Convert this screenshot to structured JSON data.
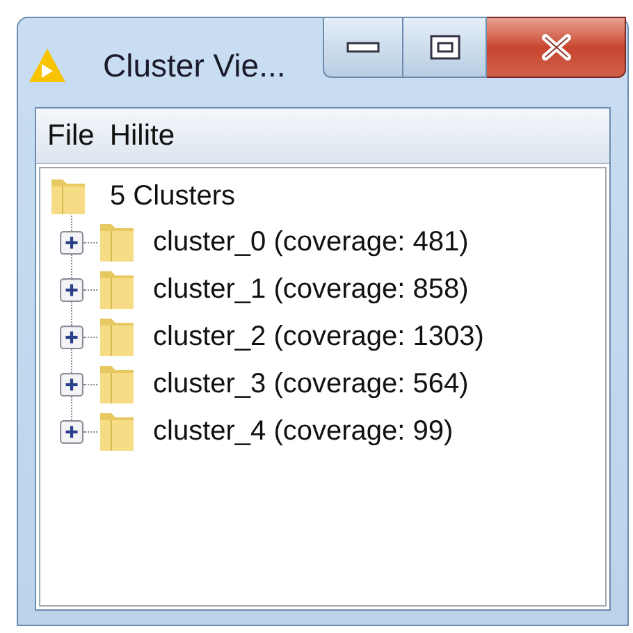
{
  "window": {
    "title": "Cluster Vie..."
  },
  "menu": [
    "File",
    "Hilite"
  ],
  "tree": {
    "label": "5 Clusters",
    "children": [
      {
        "label": "cluster_0 (coverage: 481)",
        "expanded": false
      },
      {
        "label": "cluster_1 (coverage: 858)",
        "expanded": false
      },
      {
        "label": "cluster_2 (coverage: 1303)",
        "expanded": false
      },
      {
        "label": "cluster_3 (coverage: 564)",
        "expanded": false
      },
      {
        "label": "cluster_4 (coverage: 99)",
        "expanded": false
      }
    ]
  }
}
